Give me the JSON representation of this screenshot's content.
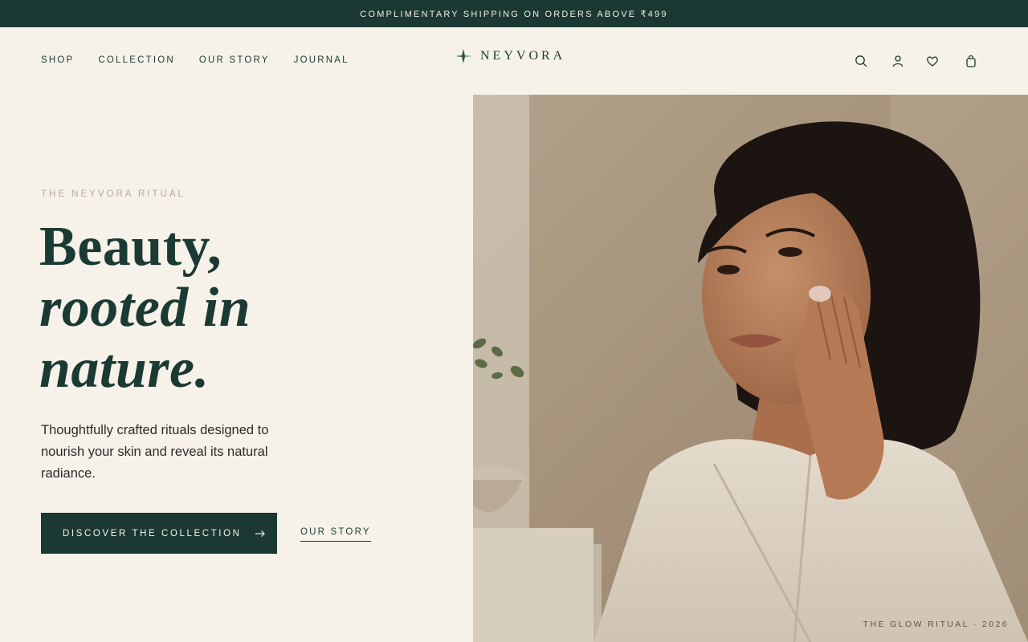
{
  "announcement": "COMPLIMENTARY SHIPPING ON ORDERS ABOVE ₹499",
  "nav": {
    "items": [
      "SHOP",
      "COLLECTION",
      "OUR STORY",
      "JOURNAL"
    ]
  },
  "brand": {
    "name": "NEYVORA",
    "mark_icon": "leaf-star-icon"
  },
  "header_icons": [
    "search-icon",
    "account-icon",
    "heart-icon",
    "bag-icon"
  ],
  "hero": {
    "eyebrow": "THE NEYVORA RITUAL",
    "headline_line1": "Beauty,",
    "headline_line2": "rooted in",
    "headline_line3": "nature.",
    "subtitle": "Thoughtfully crafted rituals designed to nourish your skin and reveal its natural radiance.",
    "primary_cta": "DISCOVER THE COLLECTION",
    "secondary_cta": "OUR STORY",
    "image_caption": "THE GLOW RITUAL · 2026"
  },
  "colors": {
    "announcement_bg": "#1b3833",
    "page_bg": "#f6f2e9",
    "primary_text": "#1b3a33",
    "eyebrow": "#b5a99b"
  }
}
